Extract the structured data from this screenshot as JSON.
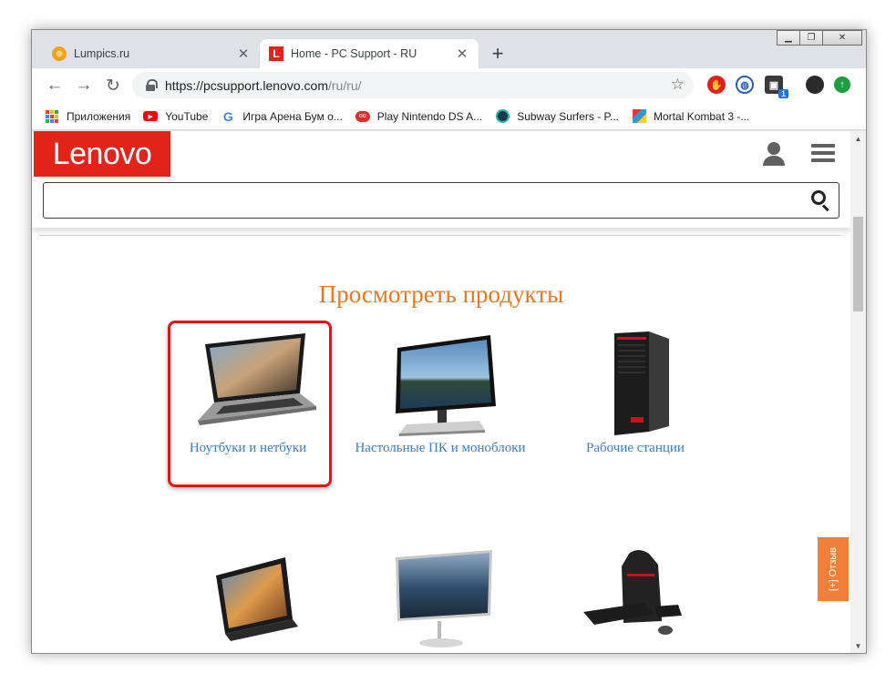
{
  "browser": {
    "tabs": [
      {
        "title": "Lumpics.ru",
        "close": "✕"
      },
      {
        "title": "Home - PC Support - RU",
        "close": "✕"
      }
    ],
    "new_tab": "+",
    "url_main": "https://pcsupport.lenovo.com",
    "url_path": "/ru/ru/",
    "extension_badge": "1",
    "bookmarks": [
      "Приложения",
      "YouTube",
      "Игра Арена Бум о...",
      "Play Nintendo DS A...",
      "Subway Surfers - P...",
      "Mortal Kombat 3 -..."
    ]
  },
  "site": {
    "logo": "Lenovo",
    "search_placeholder": "",
    "section_title": "Просмотреть продукты",
    "products": [
      {
        "label": "Ноутбуки и нетбуки",
        "icon": "laptop",
        "highlighted": true
      },
      {
        "label": "Настольные ПК и моноблоки",
        "icon": "all-in-one-pc",
        "highlighted": false
      },
      {
        "label": "Рабочие станции",
        "icon": "workstation-tower",
        "highlighted": false
      },
      {
        "label": "",
        "icon": "tablet",
        "highlighted": false
      },
      {
        "label": "",
        "icon": "monitor",
        "highlighted": false
      },
      {
        "label": "",
        "icon": "backpack-keyboard-accessories",
        "highlighted": false
      }
    ],
    "feedback": "[+] Отзыв"
  },
  "colors": {
    "brand_red": "#e2231a",
    "title_orange": "#e87722",
    "link_blue": "#3f7cbf",
    "highlight_red": "#e01616",
    "feedback_orange": "#f07f3c"
  }
}
